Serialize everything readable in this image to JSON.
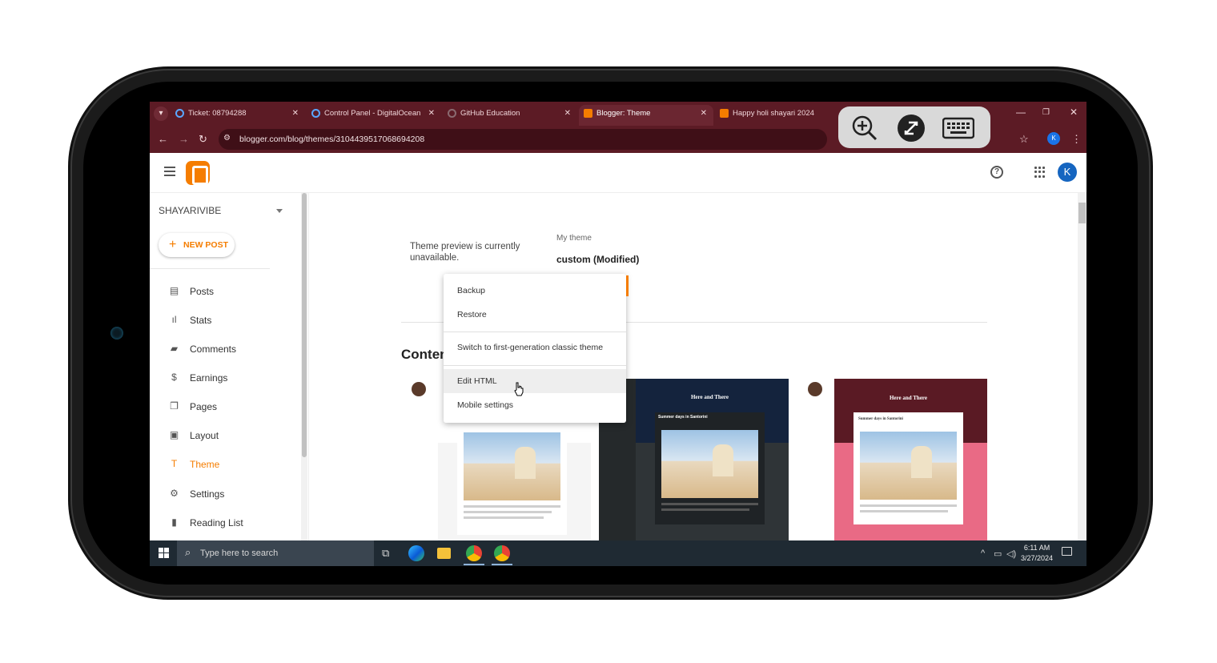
{
  "browser": {
    "tabs": [
      {
        "title": "Ticket: 08794288",
        "active": false
      },
      {
        "title": "Control Panel - DigitalOcean",
        "active": false
      },
      {
        "title": "GitHub Education",
        "active": false
      },
      {
        "title": "Blogger: Theme",
        "active": true
      },
      {
        "title": "Happy holi shayari 2024",
        "active": false
      }
    ],
    "url": "blogger.com/blog/themes/3104439517068694208",
    "profile_initial": "K"
  },
  "header": {
    "avatar_initial": "K"
  },
  "sidebar": {
    "blog_name": "SHAYARIVIBE",
    "new_post_label": "NEW POST",
    "items": [
      {
        "label": "Posts",
        "icon": "posts-icon"
      },
      {
        "label": "Stats",
        "icon": "stats-icon"
      },
      {
        "label": "Comments",
        "icon": "comments-icon"
      },
      {
        "label": "Earnings",
        "icon": "dollar-icon"
      },
      {
        "label": "Pages",
        "icon": "pages-icon"
      },
      {
        "label": "Layout",
        "icon": "layout-icon"
      },
      {
        "label": "Theme",
        "icon": "paint-roller-icon",
        "active": true
      },
      {
        "label": "Settings",
        "icon": "gear-icon"
      },
      {
        "label": "Reading List",
        "icon": "bookmark-icon"
      }
    ]
  },
  "main": {
    "preview_message": "Theme preview is currently unavailable.",
    "my_theme_label": "My theme",
    "my_theme_name": "custom (Modified)",
    "content_heading": "Conten",
    "thumbnails": [
      {
        "title": "",
        "post_title": ""
      },
      {
        "title": "Here and There",
        "post_title": "Summer days in Santorini"
      },
      {
        "title": "Here and There",
        "post_title": "Summer days in Santorini"
      }
    ]
  },
  "menu": {
    "items": [
      {
        "label": "Backup"
      },
      {
        "label": "Restore"
      },
      {
        "label": "Switch to first-generation classic theme"
      },
      {
        "label": "Edit HTML",
        "hovered": true
      },
      {
        "label": "Mobile settings"
      }
    ]
  },
  "taskbar": {
    "search_placeholder": "Type here to search",
    "time": "6:11 AM",
    "date": "3/27/2024"
  },
  "colors": {
    "accent": "#f57d00",
    "chrome_frame": "#5c1b25",
    "taskbar": "#1f2a33"
  }
}
